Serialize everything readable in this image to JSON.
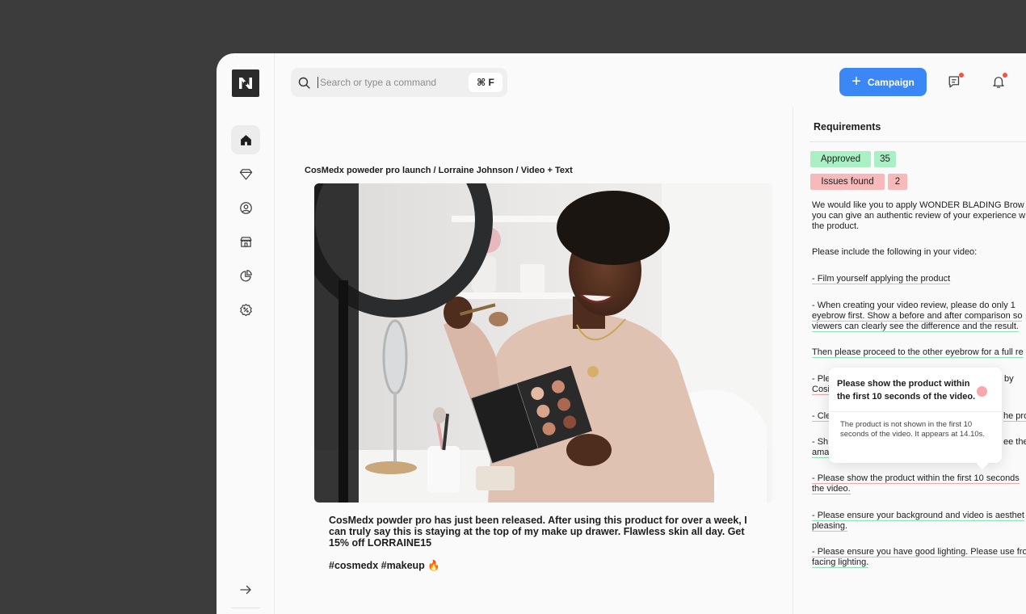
{
  "search": {
    "placeholder": "Search or type a command",
    "shortcut": "⌘ F"
  },
  "header": {
    "campaign_label": "Campaign"
  },
  "sidebar": {
    "items": [
      {
        "icon": "home-icon"
      },
      {
        "icon": "diamond-icon"
      },
      {
        "icon": "user-circle-icon"
      },
      {
        "icon": "store-icon"
      },
      {
        "icon": "pie-chart-icon"
      },
      {
        "icon": "discount-icon"
      }
    ],
    "bottom_icon": "arrow-right-icon"
  },
  "post": {
    "title": "CosMedx poweder pro launch / Lorraine Johnson / Video + Text",
    "caption": "CosMedx powder pro has just been released.  After using this product for over a week, I can truly say this is staying at the top of my make up drawer. Flawless skin all day. Get 15% off LORRAINE15",
    "hashtags": "#cosmedx #makeup 🔥"
  },
  "requirements": {
    "title": "Requirements",
    "approved_label": "Approved",
    "approved_count": "35",
    "issues_label": "Issues found",
    "issues_count": "2",
    "intro_1": "We would like you to apply WONDER BLADING Brow K",
    "intro_2": "you can give an authentic review of your experience w",
    "intro_3": "the product.",
    "include_heading": "Please include the following in your video:",
    "item_film": "- Film yourself applying the product",
    "item_review_1": "- When creating your video review, please do only 1",
    "item_review_2": "eyebrow first. Show a before and after comparison so",
    "item_review_3": "viewers can clearly see the difference and the result.",
    "item_proceed": "Then please proceed to the other eyebrow for a full re",
    "item_ple_1": "- Ple",
    "item_ple_by": "by",
    "item_ple_2": "Cosi",
    "item_cle": "- Cle",
    "item_cle_end": "he proc",
    "item_sh_1": "- Sh",
    "item_sh_end": "ee the",
    "item_sh_2": "ama",
    "item_show_1": "- Please show the product within the first 10 seconds",
    "item_show_2": "the video.",
    "item_bg_1": "- Please ensure your background and video is aesthet",
    "item_bg_2": "pleasing.",
    "item_light_1": "- Please ensure you have good lighting. Please use fro",
    "item_light_2": "facing lighting."
  },
  "popup": {
    "heading": "Please show the product within the first 10 seconds of the video.",
    "body": "The product is not shown in the first 10 seconds of the video. It appears at 14.10s."
  },
  "colors": {
    "accent": "#3a87f5",
    "approved_bg": "#a9f0c4",
    "issues_bg": "#f7b9b9",
    "notification_dot": "#f2543f"
  }
}
